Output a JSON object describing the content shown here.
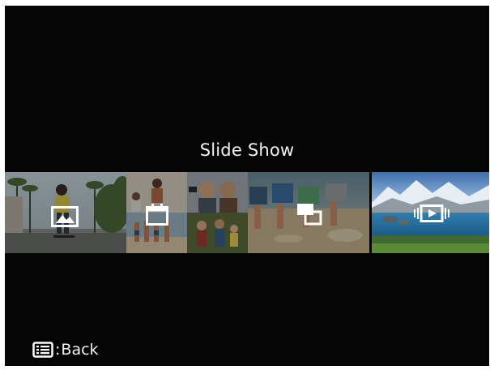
{
  "screen": {
    "title": "Slide Show",
    "footer": {
      "key_icon": "menu-list-icon",
      "separator": ":",
      "action": "Back"
    }
  },
  "options": [
    {
      "id": "single",
      "icon": "single-photo-icon",
      "selected": false
    },
    {
      "id": "by-date",
      "icon": "calendar-icon",
      "selected": false
    },
    {
      "id": "multi",
      "icon": "multi-photo-icon",
      "selected": false
    },
    {
      "id": "movie",
      "icon": "movie-playback-icon",
      "selected": true
    }
  ],
  "colors": {
    "background": "#050505",
    "text": "#f2f2f2",
    "icon": "#ffffff"
  }
}
